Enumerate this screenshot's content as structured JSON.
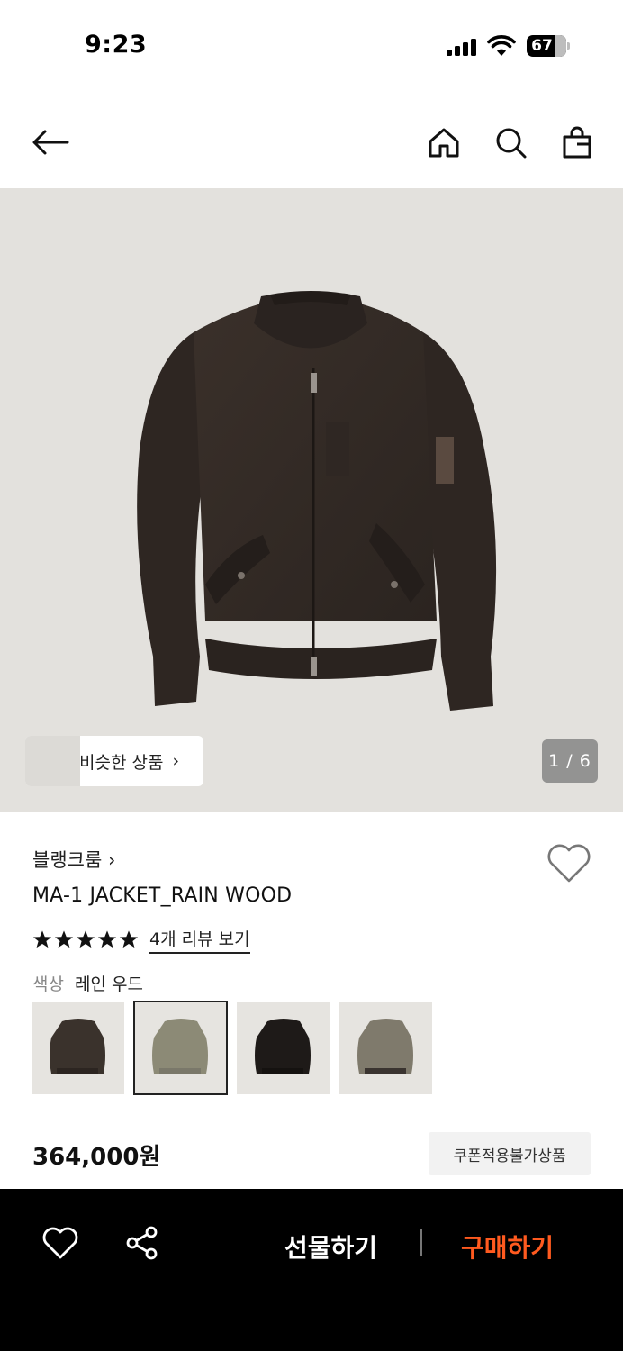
{
  "status": {
    "time": "9:23",
    "battery": "67"
  },
  "header": {
    "icons": [
      "back-arrow-icon",
      "home-icon",
      "search-icon",
      "shopping-bag-icon"
    ]
  },
  "hero": {
    "similar_label": "비슷한 상품",
    "similar_chevron": "›",
    "counter": "1 / 6"
  },
  "product": {
    "brand": "블랭크룸 ›",
    "name": "MA-1 JACKET_RAIN WOOD",
    "rating": 5,
    "reviews_label": "4개 리뷰 보기",
    "color_label": "색상",
    "color_value": "레인 우드",
    "swatches": [
      "dark-brown",
      "khaki",
      "black",
      "grey-khaki"
    ],
    "price": "364,000원",
    "coupon": "쿠폰적용불가상품"
  },
  "bottom_bar": {
    "gift": "선물하기",
    "buy": "구매하기",
    "buy_color": "#ff5a1f"
  }
}
